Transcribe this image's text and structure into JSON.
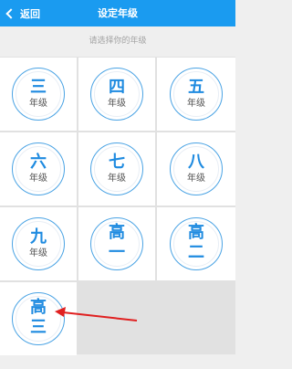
{
  "header": {
    "back_label": "返回",
    "title": "设定年级"
  },
  "subtitle": "请选择你的年级",
  "colors": {
    "header_bg": "#1a9bf0",
    "accent": "#1f8be0",
    "arrow": "#e02020"
  },
  "grades": [
    {
      "top": "三",
      "bottom": "年级"
    },
    {
      "top": "四",
      "bottom": "年级"
    },
    {
      "top": "五",
      "bottom": "年级"
    },
    {
      "top": "六",
      "bottom": "年级"
    },
    {
      "top": "七",
      "bottom": "年级"
    },
    {
      "top": "八",
      "bottom": "年级"
    },
    {
      "top": "九",
      "bottom": "年级"
    },
    {
      "top": "高",
      "bottom": "一"
    },
    {
      "top": "高",
      "bottom": "二"
    },
    {
      "top": "高",
      "bottom": "三"
    }
  ],
  "annotation": {
    "type": "arrow",
    "icon": "red-arrow-icon"
  }
}
